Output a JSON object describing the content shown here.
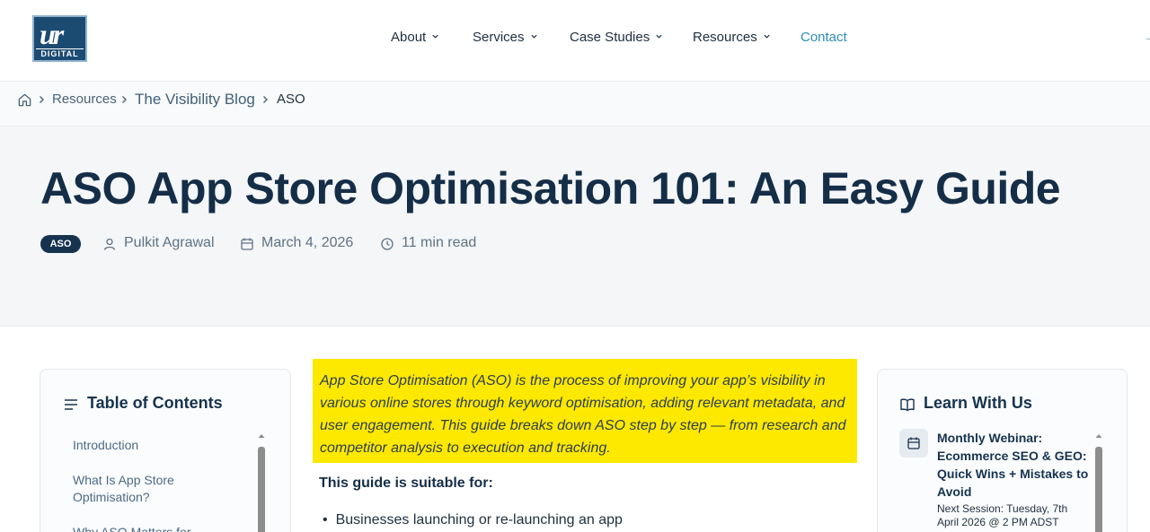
{
  "logo": {
    "mark": "ur",
    "word": "DIGITAL"
  },
  "nav": {
    "items": [
      {
        "label": "About"
      },
      {
        "label": "Services"
      },
      {
        "label": "Case Studies"
      },
      {
        "label": "Resources"
      },
      {
        "label": "Contact"
      }
    ]
  },
  "breadcrumb": {
    "items": [
      {
        "label": "Resources"
      },
      {
        "label": "The Visibility Blog"
      },
      {
        "label": "ASO"
      }
    ]
  },
  "article": {
    "title": "ASO App Store Optimisation 101: An Easy Guide",
    "tag": "ASO",
    "author": "Pulkit Agrawal",
    "date": "March 4, 2026",
    "read_time": "11 min read",
    "intro": "App Store Optimisation (ASO) is the process of improving your app’s visibility in various online stores through keyword optimisation, adding relevant metadata, and user engagement. This guide breaks down ASO step by step — from research and competitor analysis to execution and tracking.",
    "suitable_heading": "This guide is suitable for:",
    "suitable_items": [
      "Businesses launching or re-launching an app"
    ]
  },
  "toc": {
    "title": "Table of Contents",
    "items": [
      {
        "label": "Introduction"
      },
      {
        "label": "What Is App Store Optimisation?"
      },
      {
        "label": "Why ASO Matters for"
      }
    ]
  },
  "learn": {
    "title": "Learn With Us",
    "event_title": "Monthly Webinar: Ecommerce SEO & GEO: Quick Wins + Mistakes to Avoid",
    "event_session": "Next Session: Tuesday, 7th April 2026 @ 2 PM ADST"
  },
  "colors": {
    "navy": "#16334f",
    "accent_contact": "#2b8fb3",
    "highlight": "#fde800",
    "hero_bg": "#f4f6f8"
  },
  "icons": {
    "nav_chevron": "chevron-down-icon",
    "breadcrumb_home": "home-icon",
    "breadcrumb_separator": "chevron-right-icon",
    "author": "user-icon",
    "date": "calendar-icon",
    "read_time": "clock-icon",
    "toc": "list-icon",
    "learn": "book-icon",
    "event": "calendar-icon"
  }
}
